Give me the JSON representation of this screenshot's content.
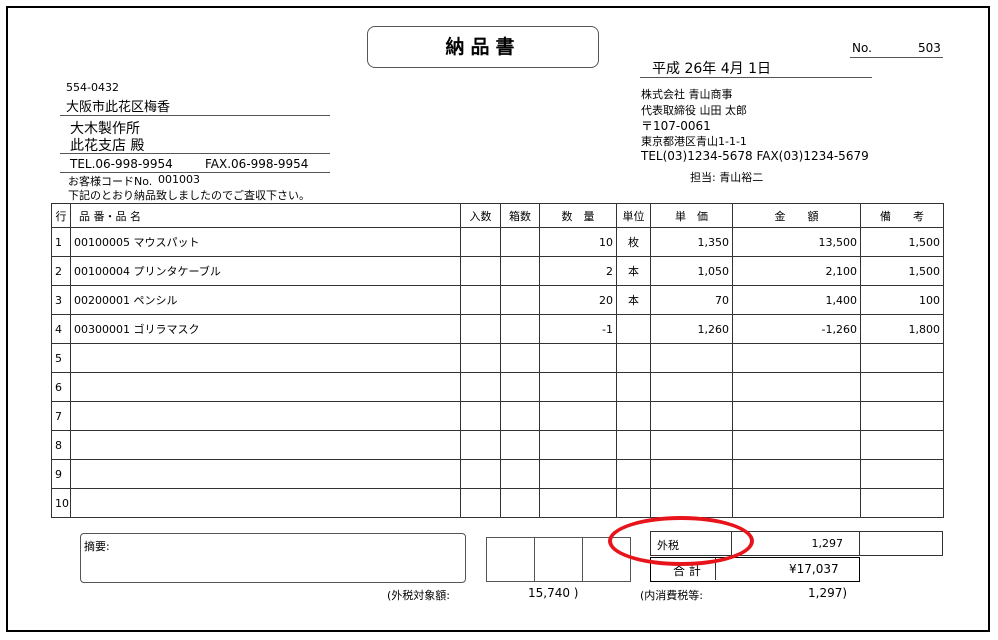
{
  "header": {
    "title": "納品書",
    "no_label": "No.",
    "no_value": "503",
    "date": "平成 26年  4月  1日"
  },
  "customer": {
    "postal": "554-0432",
    "address": "大阪市此花区梅香",
    "company": "大木製作所",
    "branch": "此花支店 殿",
    "tel": "TEL.06-998-9954",
    "fax": "FAX.06-998-9954",
    "code_label": "お客様コードNo.",
    "code_value": "001003",
    "notice": "下記のとおり納品致しましたのでご査収下さい。"
  },
  "issuer": {
    "company": "株式会社 青山商事",
    "representative": "代表取締役 山田 太郎",
    "postal": "〒107-0061",
    "address": "東京都港区青山1-1-1",
    "tel_fax": "TEL(03)1234-5678 FAX(03)1234-5679",
    "contact": "担当: 青山裕二"
  },
  "table": {
    "headers": {
      "row": "行",
      "code_name": "品 番・品 名",
      "irisu": "入数",
      "hakosu": "箱数",
      "qty": "数　量",
      "unit": "単位",
      "price": "単　価",
      "amount": "金　　額",
      "note": "備　　考"
    },
    "rows": [
      {
        "no": "1",
        "name": "00100005 マウスパット",
        "irisu": "",
        "hakosu": "",
        "qty": "10",
        "unit": "枚",
        "price": "1,350",
        "amount": "13,500",
        "note": "1,500"
      },
      {
        "no": "2",
        "name": "00100004 プリンタケーブル",
        "irisu": "",
        "hakosu": "",
        "qty": "2",
        "unit": "本",
        "price": "1,050",
        "amount": "2,100",
        "note": "1,500"
      },
      {
        "no": "3",
        "name": "00200001 ペンシル",
        "irisu": "",
        "hakosu": "",
        "qty": "20",
        "unit": "本",
        "price": "70",
        "amount": "1,400",
        "note": "100"
      },
      {
        "no": "4",
        "name": "00300001 ゴリラマスク",
        "irisu": "",
        "hakosu": "",
        "qty": "-1",
        "unit": "",
        "price": "1,260",
        "amount": "-1,260",
        "note": "1,800"
      },
      {
        "no": "5",
        "name": "",
        "irisu": "",
        "hakosu": "",
        "qty": "",
        "unit": "",
        "price": "",
        "amount": "",
        "note": ""
      },
      {
        "no": "6",
        "name": "",
        "irisu": "",
        "hakosu": "",
        "qty": "",
        "unit": "",
        "price": "",
        "amount": "",
        "note": ""
      },
      {
        "no": "7",
        "name": "",
        "irisu": "",
        "hakosu": "",
        "qty": "",
        "unit": "",
        "price": "",
        "amount": "",
        "note": ""
      },
      {
        "no": "8",
        "name": "",
        "irisu": "",
        "hakosu": "",
        "qty": "",
        "unit": "",
        "price": "",
        "amount": "",
        "note": ""
      },
      {
        "no": "9",
        "name": "",
        "irisu": "",
        "hakosu": "",
        "qty": "",
        "unit": "",
        "price": "",
        "amount": "",
        "note": ""
      },
      {
        "no": "10",
        "name": "",
        "irisu": "",
        "hakosu": "",
        "qty": "",
        "unit": "",
        "price": "",
        "amount": "",
        "note": ""
      }
    ]
  },
  "footer": {
    "memo_label": "摘要:",
    "outside_tax_label": "外税",
    "outside_tax_value": "1,297",
    "total_label": "合 計",
    "total_value": "¥17,037",
    "taxable_label": "(外税対象額:",
    "taxable_value": "15,740 )",
    "inner_tax_label": "(内消費税等:",
    "inner_tax_value": "1,297)"
  },
  "annotation": {
    "highlight_color": "#e8141b"
  }
}
